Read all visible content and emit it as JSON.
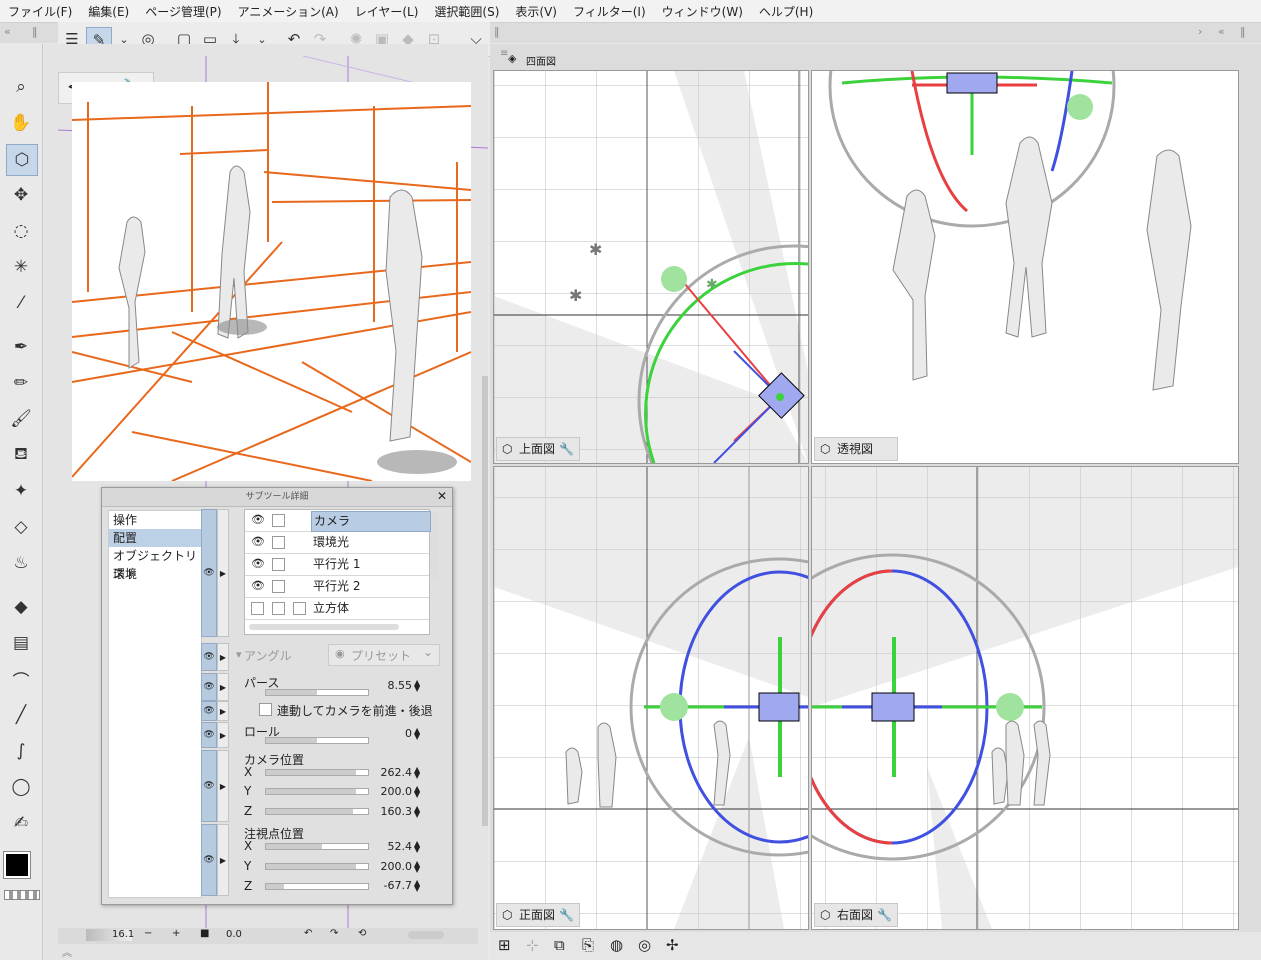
{
  "menu": [
    "ファイル(F)",
    "編集(E)",
    "ページ管理(P)",
    "アニメーション(A)",
    "レイヤー(L)",
    "選択範囲(S)",
    "表示(V)",
    "フィルター(I)",
    "ウィンドウ(W)",
    "ヘルプ(H)"
  ],
  "canvas_nav": {
    "prev": "<",
    "next": ">"
  },
  "quad_tab": "四面図",
  "subtool": {
    "title": "サブツール詳細",
    "categories": [
      "操作",
      "配置",
      "オブジェクトリスト",
      "環境"
    ],
    "selected_category": "配置",
    "objects": [
      {
        "name": "カメラ",
        "visible": true,
        "selected": true
      },
      {
        "name": "環境光",
        "visible": true,
        "selected": false
      },
      {
        "name": "平行光 1",
        "visible": true,
        "selected": false
      },
      {
        "name": "平行光 2",
        "visible": true,
        "selected": false
      },
      {
        "name": "立方体",
        "visible": false,
        "selected": false
      }
    ],
    "angle_label": "アングル",
    "preset_label": "プリセット",
    "perspective": {
      "label": "パース",
      "value": "8.55",
      "level": 0.5
    },
    "move_with_camera": {
      "label": "連動してカメラを前進・後退",
      "checked": false
    },
    "roll": {
      "label": "ロール",
      "value": "0",
      "level": 0.5
    },
    "camera_position": {
      "label": "カメラ位置",
      "x": {
        "label": "X",
        "value": "262.4",
        "level": 0.88
      },
      "y": {
        "label": "Y",
        "value": "200.0",
        "level": 0.88
      },
      "z": {
        "label": "Z",
        "value": "160.3",
        "level": 0.85
      }
    },
    "target_position": {
      "label": "注視点位置",
      "x": {
        "label": "X",
        "value": "52.4",
        "level": 0.55
      },
      "y": {
        "label": "Y",
        "value": "200.0",
        "level": 0.88
      },
      "z": {
        "label": "Z",
        "value": "-67.7",
        "level": 0.18
      }
    }
  },
  "views": {
    "top": "上面図",
    "perspective": "透視図",
    "front": "正面図",
    "right": "右面図"
  },
  "canvas_footer": {
    "zoom": "16.1",
    "angle": "0.0"
  },
  "colors": {
    "guide": "#e8681c",
    "gizmo_red": "#e84040",
    "gizmo_green": "#3cd23c",
    "gizmo_blue": "#4050e0"
  }
}
